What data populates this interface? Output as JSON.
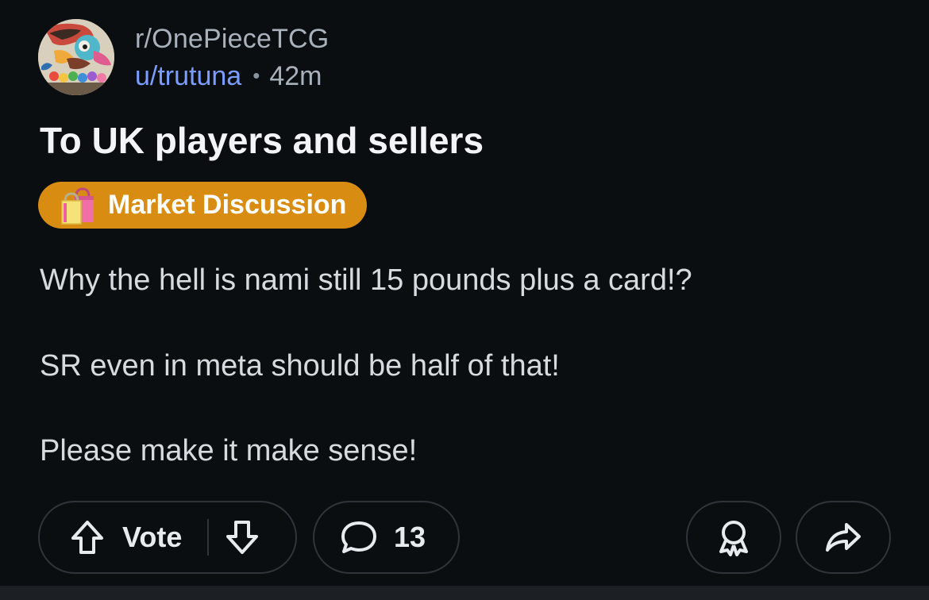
{
  "post": {
    "subreddit": "r/OnePieceTCG",
    "user": "u/trutuna",
    "separator": "•",
    "time": "42m",
    "title": "To UK players and sellers",
    "flair": {
      "icon": "shopping-bags-emoji",
      "label": "Market Discussion",
      "color": "#d98c12"
    },
    "body": [
      "Why the hell is nami still 15 pounds plus a card!?",
      "SR even in meta should be half of that!",
      "Please make it make sense!"
    ]
  },
  "actions": {
    "vote_label": "Vote",
    "upvote_icon": "arrow-up-icon",
    "downvote_icon": "arrow-down-icon",
    "comment_icon": "comment-bubble-icon",
    "comment_count": "13",
    "award_icon": "award-icon",
    "share_icon": "share-arrow-icon"
  },
  "colors": {
    "background": "#0b0e11",
    "username": "#7a9dff",
    "pill_border": "#30353b"
  }
}
